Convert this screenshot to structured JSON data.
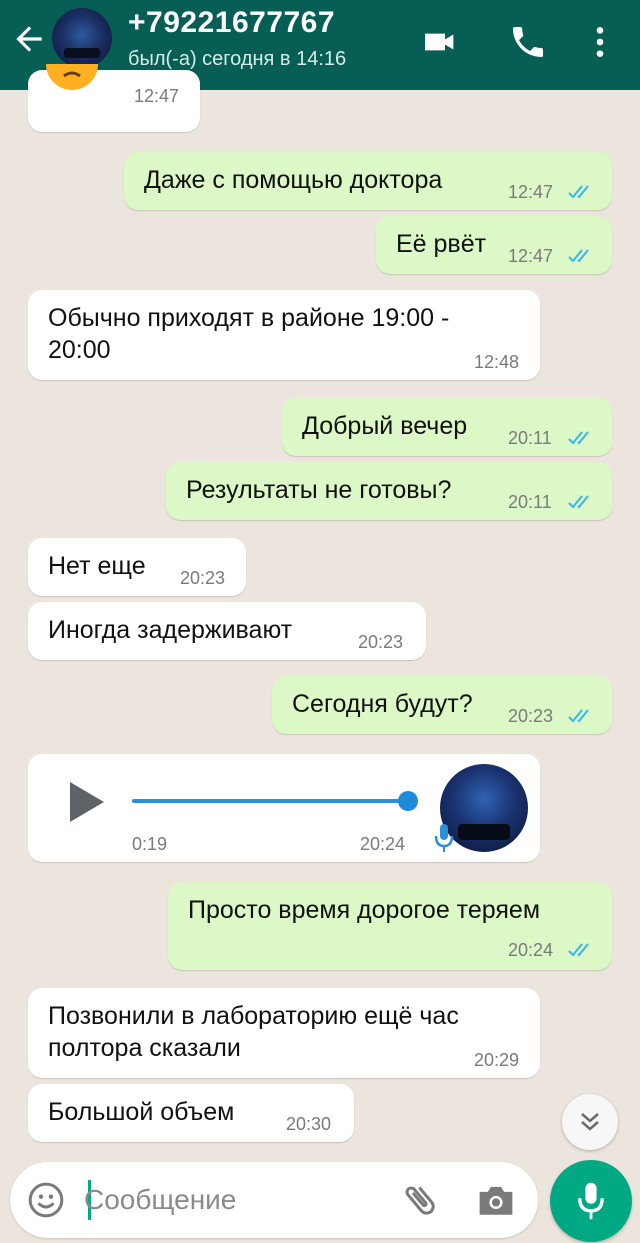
{
  "header": {
    "title": "+79221677767",
    "subtitle": "был(-а) сегодня в 14:16",
    "icons": [
      "back-arrow-icon",
      "video-call-icon",
      "phone-icon",
      "more-vert-icon"
    ],
    "color": "#075e54"
  },
  "messages": [
    {
      "dir": "in",
      "text": "",
      "time": "12:47",
      "note": "emoji-only"
    },
    {
      "dir": "out",
      "text": "Даже с помощью доктора",
      "time": "12:47"
    },
    {
      "dir": "out",
      "text": "Её рвёт",
      "time": "12:47"
    },
    {
      "dir": "in",
      "line1": "Обычно приходят в районе 19:00 -",
      "line2": "20:00",
      "time": "12:48"
    },
    {
      "dir": "out",
      "text": "Добрый вечер",
      "time": "20:11"
    },
    {
      "dir": "out",
      "text": "Результаты не готовы?",
      "time": "20:11"
    },
    {
      "dir": "in",
      "text": "Нет еще",
      "time": "20:23"
    },
    {
      "dir": "in",
      "text": "Иногда задерживают",
      "time": "20:23"
    },
    {
      "dir": "out",
      "text": "Сегодня будут?",
      "time": "20:23"
    },
    {
      "dir": "in",
      "type": "voice",
      "duration": "0:19",
      "time": "20:24"
    },
    {
      "dir": "out",
      "text": "Просто время дорогое теряем",
      "time": "20:24"
    },
    {
      "dir": "in",
      "line1": "Позвонили в лабораторию ещё час",
      "line2": "полтора сказали",
      "time": "20:29"
    },
    {
      "dir": "in",
      "text": "Большой объем",
      "time": "20:30"
    }
  ],
  "input": {
    "placeholder": "Сообщение"
  },
  "colors": {
    "accent": "#00a884",
    "outgoing_bubble": "#dcf8c6",
    "incoming_bubble": "#ffffff",
    "read_ticks": "#34b7f1",
    "background": "#ece5dd"
  }
}
